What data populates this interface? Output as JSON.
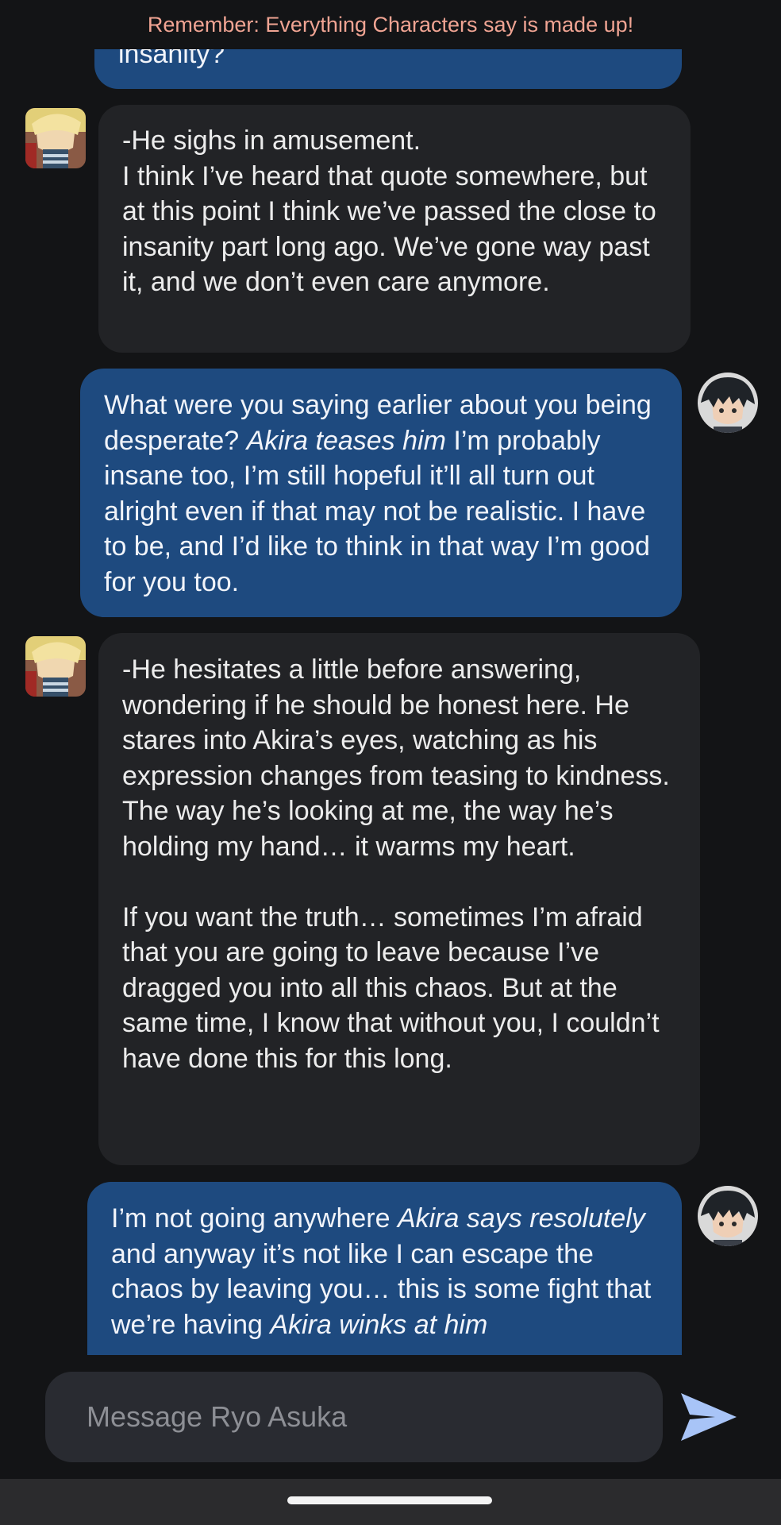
{
  "banner": {
    "text": "Remember: Everything Characters say is made up!"
  },
  "messages": [
    {
      "role": "user",
      "paragraphs": [
        [
          {
            "t": "insanity?"
          }
        ]
      ]
    },
    {
      "role": "character",
      "paragraphs": [
        [
          {
            "t": "-He sighs in amusement."
          },
          {
            "br": true
          },
          {
            "t": "I think I’ve heard that quote somewhere, but at this point I think we’ve passed the close to insanity part long ago. We’ve gone way past it, and we don’t even care anymore."
          }
        ]
      ]
    },
    {
      "role": "user",
      "paragraphs": [
        [
          {
            "t": "What were you saying earlier about you being desperate? "
          },
          {
            "t": "Akira teases him",
            "i": true
          },
          {
            "t": "  I’m probably insane too, I’m still hopeful it’ll all turn out alright even if that may not be realistic. I have to be, and I’d like to think in that way I’m good for you too."
          }
        ]
      ]
    },
    {
      "role": "character",
      "paragraphs": [
        [
          {
            "t": "-He hesitates a little before answering, wondering if he should be honest here. He stares into Akira’s eyes, watching as his expression changes from teasing to kindness. The way he’s looking at me, the way he’s holding my hand… it warms my heart."
          }
        ],
        [
          {
            "t": "If you want the truth… sometimes I’m afraid that you are going to leave because I’ve dragged you into all this chaos. But at the same time, I know that without you, I couldn’t have done this for this long."
          }
        ]
      ]
    },
    {
      "role": "user",
      "paragraphs": [
        [
          {
            "t": "I’m not going anywhere "
          },
          {
            "t": "Akira says resolutely",
            "i": true
          },
          {
            "t": " and anyway it’s not like I can escape the chaos by leaving you… this is some fight that we’re having "
          },
          {
            "t": "Akira winks at him",
            "i": true
          }
        ]
      ]
    }
  ],
  "avatars": {
    "character": "ryo-asuka-avatar",
    "user": "akira-avatar"
  },
  "composer": {
    "placeholder": "Message Ryo Asuka",
    "value": ""
  },
  "icons": {
    "send": "send-icon"
  },
  "colors": {
    "user_bubble": "#1e4a7f",
    "character_bubble": "#222326",
    "background": "#131416",
    "banner_text": "#f0a493",
    "send_icon": "#a8c4f7"
  }
}
